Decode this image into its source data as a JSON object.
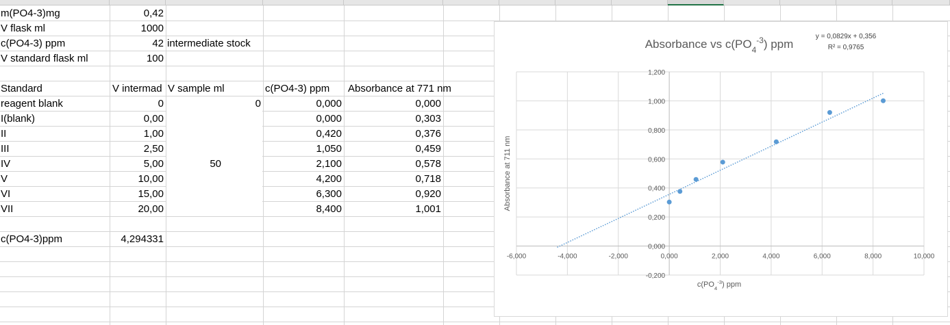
{
  "cells": {
    "r1": {
      "label": "m(PO4-3)mg",
      "value": "0,42"
    },
    "r2": {
      "label": "V flask ml",
      "value": "1000"
    },
    "r3": {
      "label": "c(PO4-3) ppm",
      "value": "42",
      "note": "intermediate stock"
    },
    "r4": {
      "label": "V standard flask ml",
      "value": "100"
    },
    "header": {
      "standard": "Standard",
      "v_intermed": "V intermad",
      "v_sample": "V sample ml",
      "conc": "c(PO4-3)  ppm",
      "abs": "Absorbance at 771 nm"
    },
    "rows": [
      {
        "name": "reagent blank",
        "v": "0",
        "vs": "0",
        "c": "0,000",
        "a": "0,000"
      },
      {
        "name": "I(blank)",
        "v": "0,00",
        "c": "0,000",
        "a": "0,303"
      },
      {
        "name": "II",
        "v": "1,00",
        "c": "0,420",
        "a": "0,376"
      },
      {
        "name": "III",
        "v": "2,50",
        "c": "1,050",
        "a": "0,459"
      },
      {
        "name": "IV",
        "v": "5,00",
        "vs": "50",
        "c": "2,100",
        "a": "0,578"
      },
      {
        "name": "V",
        "v": "10,00",
        "c": "4,200",
        "a": "0,718"
      },
      {
        "name": "VI",
        "v": "15,00",
        "c": "6,300",
        "a": "0,920"
      },
      {
        "name": "VII",
        "v": "20,00",
        "c": "8,400",
        "a": "1,001"
      }
    ],
    "result": {
      "label": "c(PO4-3)ppm",
      "value": "4,294331"
    }
  },
  "chart_data": {
    "type": "scatter",
    "title": "Absorbance vs c(PO4-3) ppm",
    "title_parts": {
      "pre": "Absorbance vs c(PO",
      "sub": "4",
      "sup": "-3",
      "post": ")  ppm"
    },
    "xlabel": "c(PO4-3) ppm",
    "xlabel_parts": {
      "pre": "c(PO",
      "sub": "4",
      "sup": "-3",
      "post": ")  ppm"
    },
    "ylabel": "Absorbance at 711 nm",
    "xlim": [
      -6,
      10
    ],
    "ylim": [
      -0.2,
      1.2
    ],
    "x_ticks": [
      -6,
      -4,
      -2,
      0,
      2,
      4,
      6,
      8,
      10
    ],
    "y_ticks": [
      -0.2,
      0,
      0.2,
      0.4,
      0.6,
      0.8,
      1.0,
      1.2
    ],
    "x_tick_labels": [
      "-6,000",
      "-4,000",
      "-2,000",
      "0,000",
      "2,000",
      "4,000",
      "6,000",
      "8,000",
      "10,000"
    ],
    "y_tick_labels": [
      "-0,200",
      "0,000",
      "0,200",
      "0,400",
      "0,600",
      "0,800",
      "1,000",
      "1,200"
    ],
    "grid": true,
    "x": [
      0,
      0.42,
      1.05,
      2.1,
      4.2,
      6.3,
      8.4
    ],
    "y": [
      0.303,
      0.376,
      0.459,
      0.578,
      0.718,
      0.92,
      1.001
    ],
    "trendline": {
      "slope": 0.0829,
      "intercept": 0.356,
      "x_range": [
        -4.4,
        8.4
      ]
    },
    "equation": "y = 0,0829x + 0,356",
    "r2": "R² = 0,9765",
    "colors": {
      "points": "#5b9bd5",
      "trend": "#5b9bd5",
      "grid": "#d9d9d9",
      "text": "#595959"
    }
  }
}
